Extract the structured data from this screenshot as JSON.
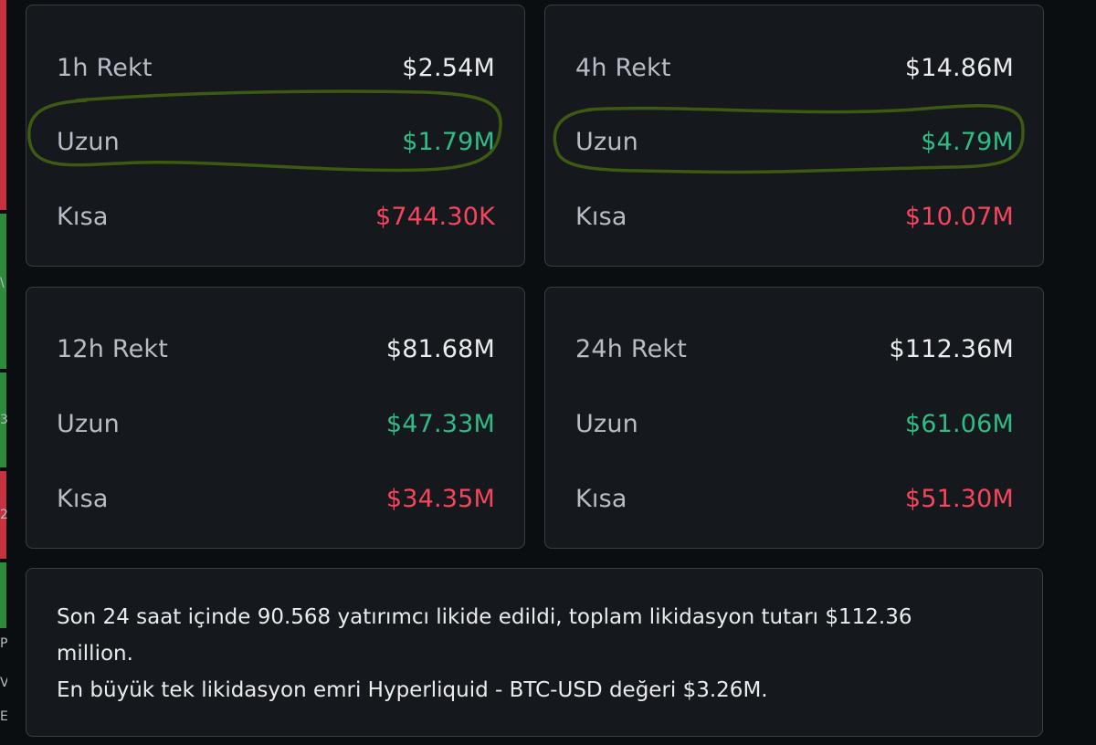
{
  "colors": {
    "background": "#0b0e11",
    "card": "#15181d",
    "border": "#3a3f47",
    "long": "#2ebd85",
    "short": "#f6465d",
    "highlight": "#3d5a12"
  },
  "edge": {
    "chars": [
      "\\",
      "3",
      "2",
      "P",
      "V",
      "E"
    ]
  },
  "cards": [
    {
      "title": "1h Rekt",
      "total": "$2.54M",
      "long_label": "Uzun",
      "long_value": "$1.79M",
      "short_label": "Kısa",
      "short_value": "$744.30K"
    },
    {
      "title": "4h Rekt",
      "total": "$14.86M",
      "long_label": "Uzun",
      "long_value": "$4.79M",
      "short_label": "Kısa",
      "short_value": "$10.07M"
    },
    {
      "title": "12h Rekt",
      "total": "$81.68M",
      "long_label": "Uzun",
      "long_value": "$47.33M",
      "short_label": "Kısa",
      "short_value": "$34.35M"
    },
    {
      "title": "24h Rekt",
      "total": "$112.36M",
      "long_label": "Uzun",
      "long_value": "$61.06M",
      "short_label": "Kısa",
      "short_value": "$51.30M"
    }
  ],
  "summary": {
    "line1": "Son 24 saat içinde 90.568 yatırımcı likide edildi, toplam likidasyon tutarı $112.36 million.",
    "line2": "En büyük tek likidasyon emri Hyperliquid - BTC-USD değeri $3.26M."
  }
}
